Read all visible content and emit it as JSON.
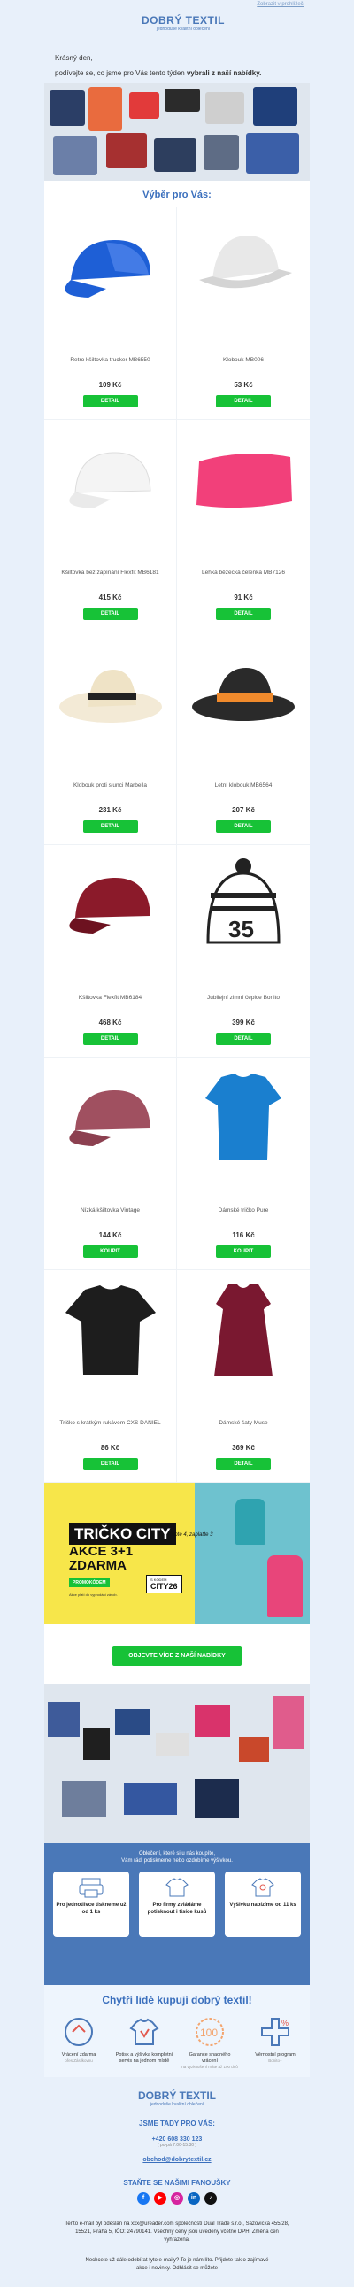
{
  "header": {
    "web_link": "Zobrazit v prohlížeči",
    "brand": "DOBRÝ TEXTIL",
    "tagline": "jednoduše kvalitní oblečení"
  },
  "intro": {
    "greeting": "Krásný den,",
    "text_prefix": "podívejte se, co jsme pro Vás tento týden ",
    "text_bold": "vybrali z naší nabídky."
  },
  "section_title": "Výběr pro Vás:",
  "products": [
    {
      "name": "Retro kšiltovka trucker MB6550",
      "price": "109 Kč",
      "button": "DETAIL",
      "icon": "trucker-cap-icon",
      "color": "#1e5fd6"
    },
    {
      "name": "Klobouk MB006",
      "price": "53 Kč",
      "button": "DETAIL",
      "icon": "bucket-hat-icon",
      "color": "#e8e8e8"
    },
    {
      "name": "Kšiltovka bez zapínání Flexfit MB6181",
      "price": "415 Kč",
      "button": "DETAIL",
      "icon": "cap-icon",
      "color": "#f4f4f4"
    },
    {
      "name": "Lehká běžecká čelenka MB7126",
      "price": "91 Kč",
      "button": "DETAIL",
      "icon": "headband-icon",
      "color": "#f2407a"
    },
    {
      "name": "Klobouk proti slunci Marbella",
      "price": "231 Kč",
      "button": "DETAIL",
      "icon": "sun-hat-icon",
      "color": "#f3ead6"
    },
    {
      "name": "Letní klobouk MB6564",
      "price": "207 Kč",
      "button": "DETAIL",
      "icon": "fedora-icon",
      "color": "#2a2a2a"
    },
    {
      "name": "Kšiltovka Flexfit MB6184",
      "price": "468 Kč",
      "button": "DETAIL",
      "icon": "flexfit-cap-icon",
      "color": "#8b1a2a"
    },
    {
      "name": "Jubilejní zimní čepice Bonito",
      "price": "399 Kč",
      "button": "DETAIL",
      "icon": "beanie-icon",
      "color": "#222222"
    },
    {
      "name": "Nízká kšiltovka Vintage",
      "price": "144 Kč",
      "button": "KOUPIT",
      "icon": "vintage-cap-icon",
      "color": "#a05060"
    },
    {
      "name": "Dámské tričko Pure",
      "price": "116 Kč",
      "button": "KOUPIT",
      "icon": "tshirt-icon",
      "color": "#1a7fcf"
    },
    {
      "name": "Tričko s krátkým rukávem CXS DANIEL",
      "price": "86 Kč",
      "button": "DETAIL",
      "icon": "black-tshirt-icon",
      "color": "#1d1d1d"
    },
    {
      "name": "Dámské šaty Muse",
      "price": "369 Kč",
      "button": "DETAIL",
      "icon": "dress-icon",
      "color": "#7a1830"
    }
  ],
  "promo": {
    "line1": "TRIČKO CITY",
    "line2": "AKCE 3+1",
    "line3": "ZDARMA",
    "handnote": "Kupte 4, zaplaťte 3",
    "code_label": "PROMOKÓDEM",
    "code_small": "S KÓDEM",
    "code": "CITY26",
    "note": "Akce platí do vyprodání zásob."
  },
  "more_button": "OBJEVTE VÍCE Z NAŠÍ NABÍDKY",
  "benefits": {
    "intro1": "Oblečení, které si u nás koupíte,",
    "intro2": "Vám rádi potiskneme nebo ozdobíme výšivkou.",
    "items": [
      {
        "label": "Pro jednotlivce tiskneme už od 1 ks",
        "icon": "printer-icon"
      },
      {
        "label": "Pro firmy zvládáme potisknout i tisíce kusů",
        "icon": "shirt-stack-icon"
      },
      {
        "label": "Výšivku nabízíme od 11 ks",
        "icon": "embroidery-shirt-icon"
      }
    ]
  },
  "smart": {
    "title": "Chytří lidé kupují dobrý textil!",
    "items": [
      {
        "t": "Vrácení zdarma",
        "t2": "přes Zásilkovnu",
        "icon": "return-icon"
      },
      {
        "t": "Potisk a výšivka kompletní servis na jednom místě",
        "t2": "",
        "icon": "print-service-icon"
      },
      {
        "t": "Garance snadného vrácení",
        "t2": "na vyzkoušení máte až 100 dnů",
        "icon": "100-days-icon"
      },
      {
        "t": "Věrnostní program",
        "t2": "Bonito+",
        "icon": "loyalty-icon"
      }
    ]
  },
  "footer": {
    "brand": "DOBRÝ TEXTIL",
    "tagline": "jednoduše kvalitní oblečení",
    "contact_title": "JSME TADY PRO VÁS:",
    "phone": "+420 608 330 123",
    "hours": "( po-pá 7:00-15:30 )",
    "email": "obchod@dobrytextil.cz",
    "fans_title": "STAŇTE SE NAŠIMI FANOUŠKY",
    "social": [
      {
        "icon": "facebook-icon",
        "glyph": "f",
        "color": "#1877f2"
      },
      {
        "icon": "youtube-icon",
        "glyph": "▶",
        "color": "#ff0000"
      },
      {
        "icon": "instagram-icon",
        "glyph": "◎",
        "color": "#d6249f"
      },
      {
        "icon": "linkedin-icon",
        "glyph": "in",
        "color": "#0a66c2"
      },
      {
        "icon": "tiktok-icon",
        "glyph": "♪",
        "color": "#111111"
      }
    ],
    "legal": "Tento e-mail byl odeslán na xxx@ureader.com společností Dual Trade s.r.o., Sazovická 455/28, 15521, Praha 5, IČO: 24790141. Všechny ceny jsou uvedeny včetně DPH. Změna cen vyhrazena.",
    "unsub": "Nechcete už dále odebírat tyto e-maily? To je nám líto. Přijdete tak o zajímavé akce i novinky. Odhlásit se můžete"
  }
}
